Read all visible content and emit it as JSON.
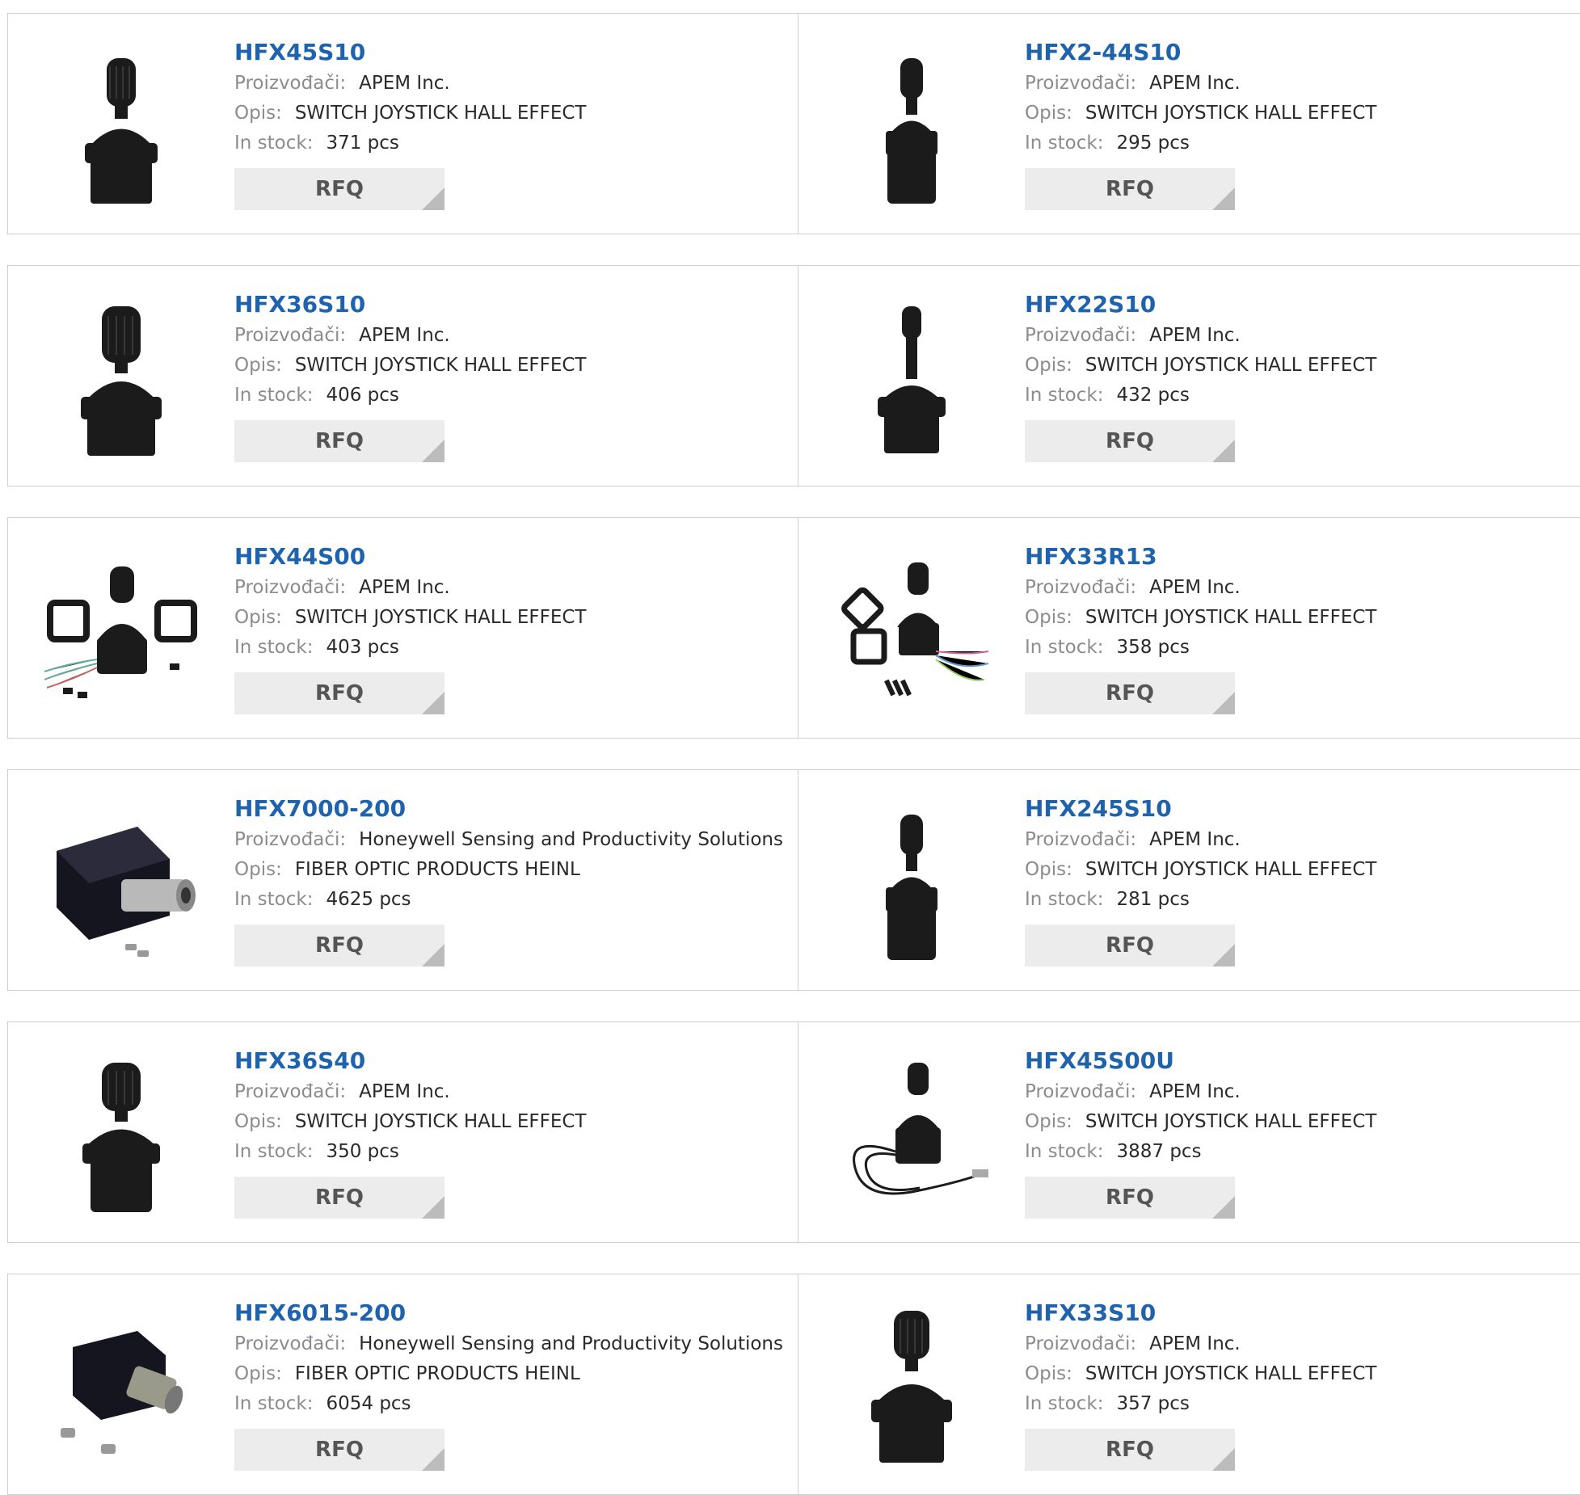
{
  "labels": {
    "manufacturer": "Proizvođači:",
    "description": "Opis:",
    "stock": "In stock:",
    "rfq": "RFQ"
  },
  "products": [
    {
      "part": "HFX45S10",
      "manufacturer": "APEM Inc.",
      "description": "SWITCH JOYSTICK HALL EFFECT",
      "stock": "371 pcs",
      "image": "joystick-knob-image"
    },
    {
      "part": "HFX2-44S10",
      "manufacturer": "APEM Inc.",
      "description": "SWITCH JOYSTICK HALL EFFECT",
      "stock": "295 pcs",
      "image": "joystick-tall-body-image"
    },
    {
      "part": "HFX36S10",
      "manufacturer": "APEM Inc.",
      "description": "SWITCH JOYSTICK HALL EFFECT",
      "stock": "406 pcs",
      "image": "joystick-knob-image"
    },
    {
      "part": "HFX22S10",
      "manufacturer": "APEM Inc.",
      "description": "SWITCH JOYSTICK HALL EFFECT",
      "stock": "432 pcs",
      "image": "joystick-stick-image"
    },
    {
      "part": "HFX44S00",
      "manufacturer": "APEM Inc.",
      "description": "SWITCH JOYSTICK HALL EFFECT",
      "stock": "403 pcs",
      "image": "joystick-kit-image"
    },
    {
      "part": "HFX33R13",
      "manufacturer": "APEM Inc.",
      "description": "SWITCH JOYSTICK HALL EFFECT",
      "stock": "358 pcs",
      "image": "joystick-kit-image"
    },
    {
      "part": "HFX7000-200",
      "manufacturer": "Honeywell Sensing and Productivity Solutions",
      "description": "FIBER OPTIC PRODUCTS HEINL",
      "stock": "4625 pcs",
      "image": "fiber-optic-connector-image"
    },
    {
      "part": "HFX245S10",
      "manufacturer": "APEM Inc.",
      "description": "SWITCH JOYSTICK HALL EFFECT",
      "stock": "281 pcs",
      "image": "joystick-tall-body-image"
    },
    {
      "part": "HFX36S40",
      "manufacturer": "APEM Inc.",
      "description": "SWITCH JOYSTICK HALL EFFECT",
      "stock": "350 pcs",
      "image": "joystick-knob-image"
    },
    {
      "part": "HFX45S00U",
      "manufacturer": "APEM Inc.",
      "description": "SWITCH JOYSTICK HALL EFFECT",
      "stock": "3887 pcs",
      "image": "joystick-usb-cable-image"
    },
    {
      "part": "HFX6015-200",
      "manufacturer": "Honeywell Sensing and Productivity Solutions",
      "description": "FIBER OPTIC PRODUCTS HEINL",
      "stock": "6054 pcs",
      "image": "fiber-optic-connector-image"
    },
    {
      "part": "HFX33S10",
      "manufacturer": "APEM Inc.",
      "description": "SWITCH JOYSTICK HALL EFFECT",
      "stock": "357 pcs",
      "image": "joystick-knob-image"
    }
  ]
}
